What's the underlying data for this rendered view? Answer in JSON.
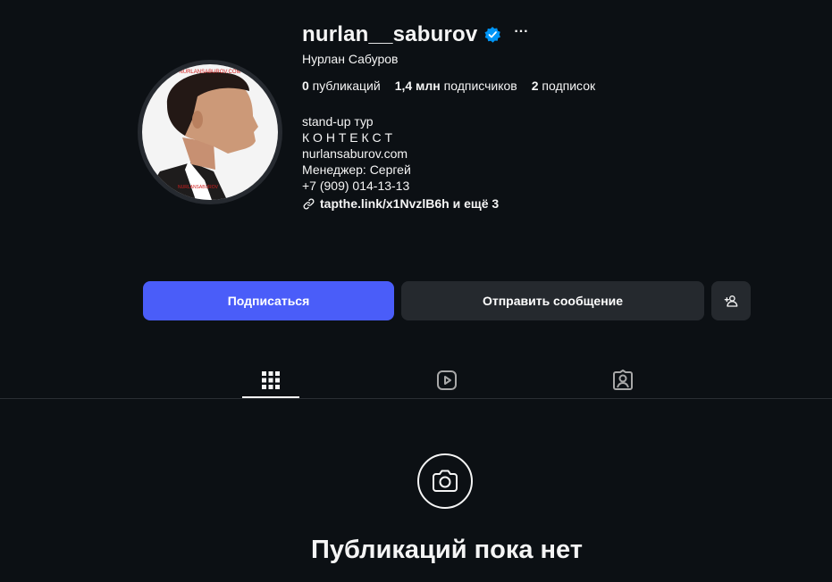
{
  "profile": {
    "username": "nurlan__saburov",
    "more": "···",
    "full_name": "Нурлан Сабуров",
    "avatar_watermark_top": "NURLANSABUROV.COM",
    "avatar_watermark_bottom": "NURLANSABUROV"
  },
  "stats": {
    "posts_count": "0",
    "posts_label": " публикаций",
    "followers_count": "1,4 млн",
    "followers_label": " подписчиков",
    "following_count": "2",
    "following_label": " подписок"
  },
  "bio": {
    "lines": [
      "stand-up тур",
      "К О Н Т Е К С Т",
      "nurlansaburov.com",
      "Менеджер: Сергей",
      "+7 (909) 014-13-13"
    ],
    "link": "tapthe.link/x1NvzlB6h и ещё 3"
  },
  "actions": {
    "follow": "Подписаться",
    "message": "Отправить сообщение"
  },
  "empty_state": {
    "title": "Публикаций пока нет"
  },
  "colors": {
    "background": "#0c1014",
    "accent": "#4a5df9",
    "secondary_button": "#25292e",
    "verified": "#0095f6"
  },
  "icons": [
    "verified-badge-icon",
    "link-icon",
    "add-person-icon",
    "grid-icon",
    "reels-icon",
    "tagged-icon",
    "camera-icon"
  ]
}
